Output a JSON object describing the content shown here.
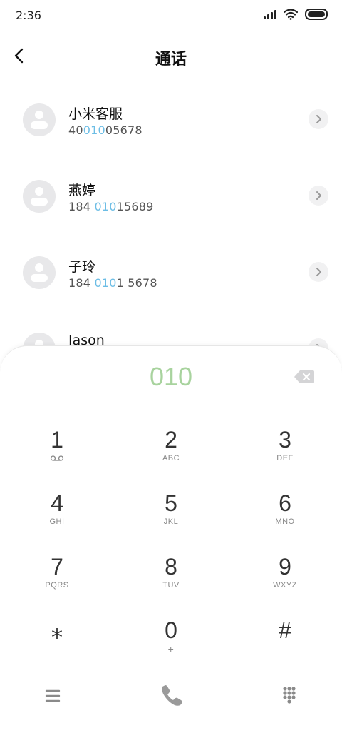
{
  "status_bar": {
    "time": "2:36"
  },
  "header": {
    "title": "通话"
  },
  "contacts": [
    {
      "name": "小米客服",
      "number_pre": "40",
      "number_hl": "010",
      "number_post": "05678"
    },
    {
      "name": "燕婷",
      "number_pre": "184 ",
      "number_hl": "010",
      "number_post": "15689"
    },
    {
      "name": "子玲",
      "number_pre": "184 ",
      "number_hl": "010",
      "number_post": "1 5678"
    },
    {
      "name": "Jason",
      "number_pre": "",
      "number_hl": "",
      "number_post": ""
    }
  ],
  "dialer": {
    "number": "010",
    "keys": [
      {
        "digit": "1",
        "letters": ""
      },
      {
        "digit": "2",
        "letters": "ABC"
      },
      {
        "digit": "3",
        "letters": "DEF"
      },
      {
        "digit": "4",
        "letters": "GHI"
      },
      {
        "digit": "5",
        "letters": "JKL"
      },
      {
        "digit": "6",
        "letters": "MNO"
      },
      {
        "digit": "7",
        "letters": "PQRS"
      },
      {
        "digit": "8",
        "letters": "TUV"
      },
      {
        "digit": "9",
        "letters": "WXYZ"
      },
      {
        "digit": "⁎",
        "letters": ""
      },
      {
        "digit": "0",
        "letters": "+"
      },
      {
        "digit": "#",
        "letters": ""
      }
    ]
  },
  "colors": {
    "highlight": "#6cbde5",
    "dialed_number": "#a8d39e"
  },
  "icons": [
    "back-icon",
    "signal-icon",
    "wifi-icon",
    "battery-icon",
    "avatar-icon",
    "chevron-right-icon",
    "backspace-icon",
    "voicemail-icon",
    "menu-icon",
    "phone-icon",
    "keypad-icon"
  ]
}
